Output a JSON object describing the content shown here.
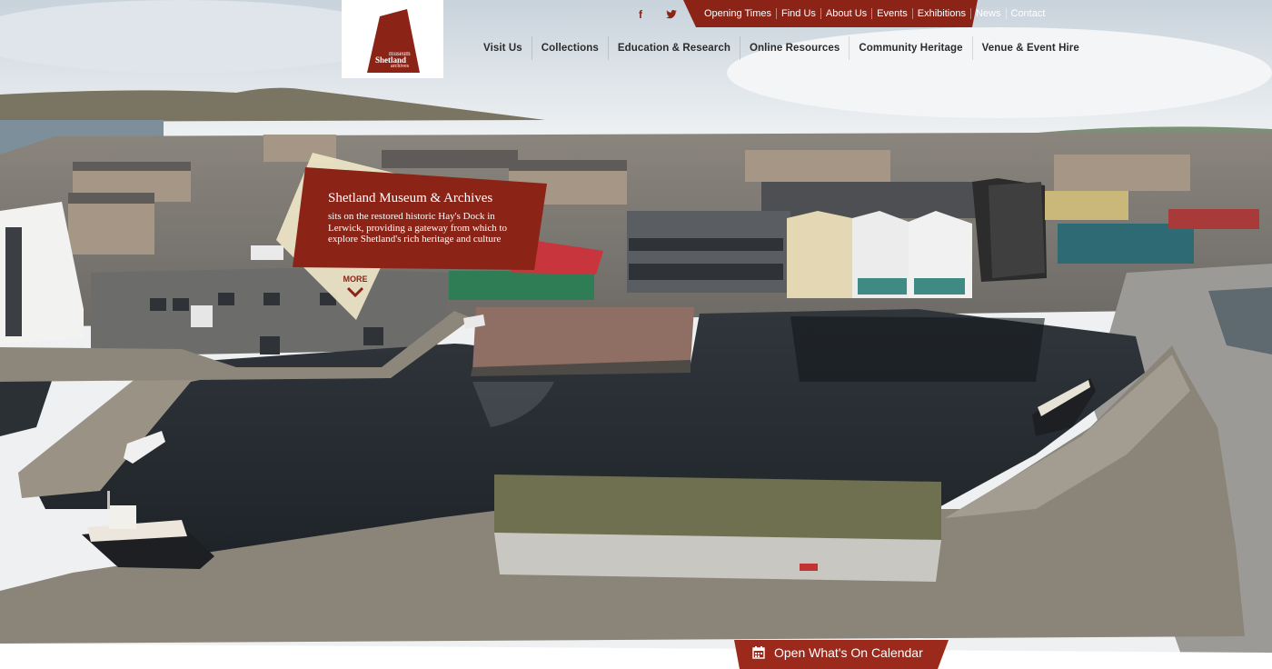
{
  "brand": {
    "logo_line1": "museum",
    "logo_line2": "Shetland",
    "logo_line3": "archives",
    "color_primary": "#8b2317",
    "color_primary_dark": "#7a1d12"
  },
  "social": {
    "facebook_icon": "facebook-icon",
    "twitter_icon": "twitter-icon",
    "facebook_glyph": "f",
    "twitter_glyph": "t"
  },
  "top_links": [
    {
      "label": "Opening Times"
    },
    {
      "label": "Find Us"
    },
    {
      "label": "About Us"
    },
    {
      "label": "Events"
    },
    {
      "label": "Exhibitions"
    },
    {
      "label": "News"
    },
    {
      "label": "Contact"
    }
  ],
  "main_nav": [
    {
      "label": "Visit Us"
    },
    {
      "label": "Collections"
    },
    {
      "label": "Education & Research"
    },
    {
      "label": "Online Resources"
    },
    {
      "label": "Community Heritage"
    },
    {
      "label": "Venue & Event Hire"
    }
  ],
  "callout": {
    "title": "Shetland Museum & Archives",
    "body": "sits on the restored historic Hay's Dock in Lerwick, providing a gateway from which to explore Shetland's rich heritage and culture",
    "more_label": "MORE"
  },
  "calendar_button": {
    "label": "Open What's On Calendar",
    "icon": "calendar-icon"
  }
}
